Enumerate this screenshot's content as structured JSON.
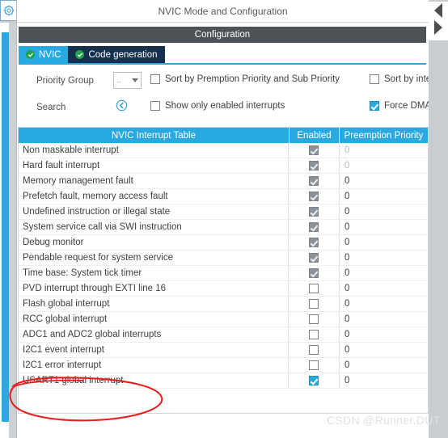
{
  "window": {
    "title": "NVIC Mode and Configuration",
    "config_bar_label": "Configuration"
  },
  "icons": {
    "gear": "gear-icon",
    "collapse_left": "triangle-left-icon",
    "collapse_right": "triangle-right-icon",
    "search": "search-prev-circle-icon"
  },
  "tabs": [
    {
      "label": "NVIC",
      "active": true
    },
    {
      "label": "Code generation",
      "active": false
    }
  ],
  "options": {
    "priority_group_label": "Priority Group",
    "priority_group_value": "..",
    "search_label": "Search",
    "search_value": "",
    "checkboxes": [
      {
        "label": "Sort by Premption Priority and Sub Priority",
        "checked": false
      },
      {
        "label": "Sort by interrupts",
        "checked": false
      },
      {
        "label": "Show only enabled interrupts",
        "checked": false
      },
      {
        "label": "Force DMA chan",
        "checked": true
      }
    ]
  },
  "table": {
    "columns": [
      "NVIC Interrupt Table",
      "Enabled",
      "Preemption Priority"
    ],
    "rows": [
      {
        "name": "Non maskable interrupt",
        "enabled": true,
        "state": "locked",
        "priority": "0",
        "dim": true
      },
      {
        "name": "Hard fault interrupt",
        "enabled": true,
        "state": "locked",
        "priority": "0",
        "dim": true
      },
      {
        "name": "Memory management fault",
        "enabled": true,
        "state": "locked",
        "priority": "0",
        "dim": false
      },
      {
        "name": "Prefetch fault, memory access fault",
        "enabled": true,
        "state": "locked",
        "priority": "0",
        "dim": false
      },
      {
        "name": "Undefined instruction or illegal state",
        "enabled": true,
        "state": "locked",
        "priority": "0",
        "dim": false
      },
      {
        "name": "System service call via SWI instruction",
        "enabled": true,
        "state": "locked",
        "priority": "0",
        "dim": false
      },
      {
        "name": "Debug monitor",
        "enabled": true,
        "state": "locked",
        "priority": "0",
        "dim": false
      },
      {
        "name": "Pendable request for system service",
        "enabled": true,
        "state": "locked",
        "priority": "0",
        "dim": false
      },
      {
        "name": "Time base: System tick timer",
        "enabled": true,
        "state": "locked",
        "priority": "0",
        "dim": false
      },
      {
        "name": "PVD interrupt through EXTI line 16",
        "enabled": false,
        "state": "normal",
        "priority": "0",
        "dim": false
      },
      {
        "name": "Flash global interrupt",
        "enabled": false,
        "state": "normal",
        "priority": "0",
        "dim": false
      },
      {
        "name": "RCC global interrupt",
        "enabled": false,
        "state": "normal",
        "priority": "0",
        "dim": false
      },
      {
        "name": "ADC1 and ADC2 global interrupts",
        "enabled": false,
        "state": "normal",
        "priority": "0",
        "dim": false
      },
      {
        "name": "I2C1 event interrupt",
        "enabled": false,
        "state": "normal",
        "priority": "0",
        "dim": false
      },
      {
        "name": "I2C1 error interrupt",
        "enabled": false,
        "state": "normal",
        "priority": "0",
        "dim": false
      },
      {
        "name": "USART1 global interrupt",
        "enabled": true,
        "state": "active",
        "priority": "0",
        "dim": false
      }
    ]
  },
  "annotation": {
    "shape": "hand-drawn-red-ellipse",
    "color": "#e8201e",
    "targets": "USART1 global interrupt"
  },
  "watermark": {
    "text": "CSDN @Runner.DUT"
  },
  "colors": {
    "accent_blue": "#29a9e1",
    "tab_inactive": "#14304d",
    "config_bar": "#4d5256",
    "green_check": "#22a24a",
    "annotation_red": "#e8201e"
  }
}
